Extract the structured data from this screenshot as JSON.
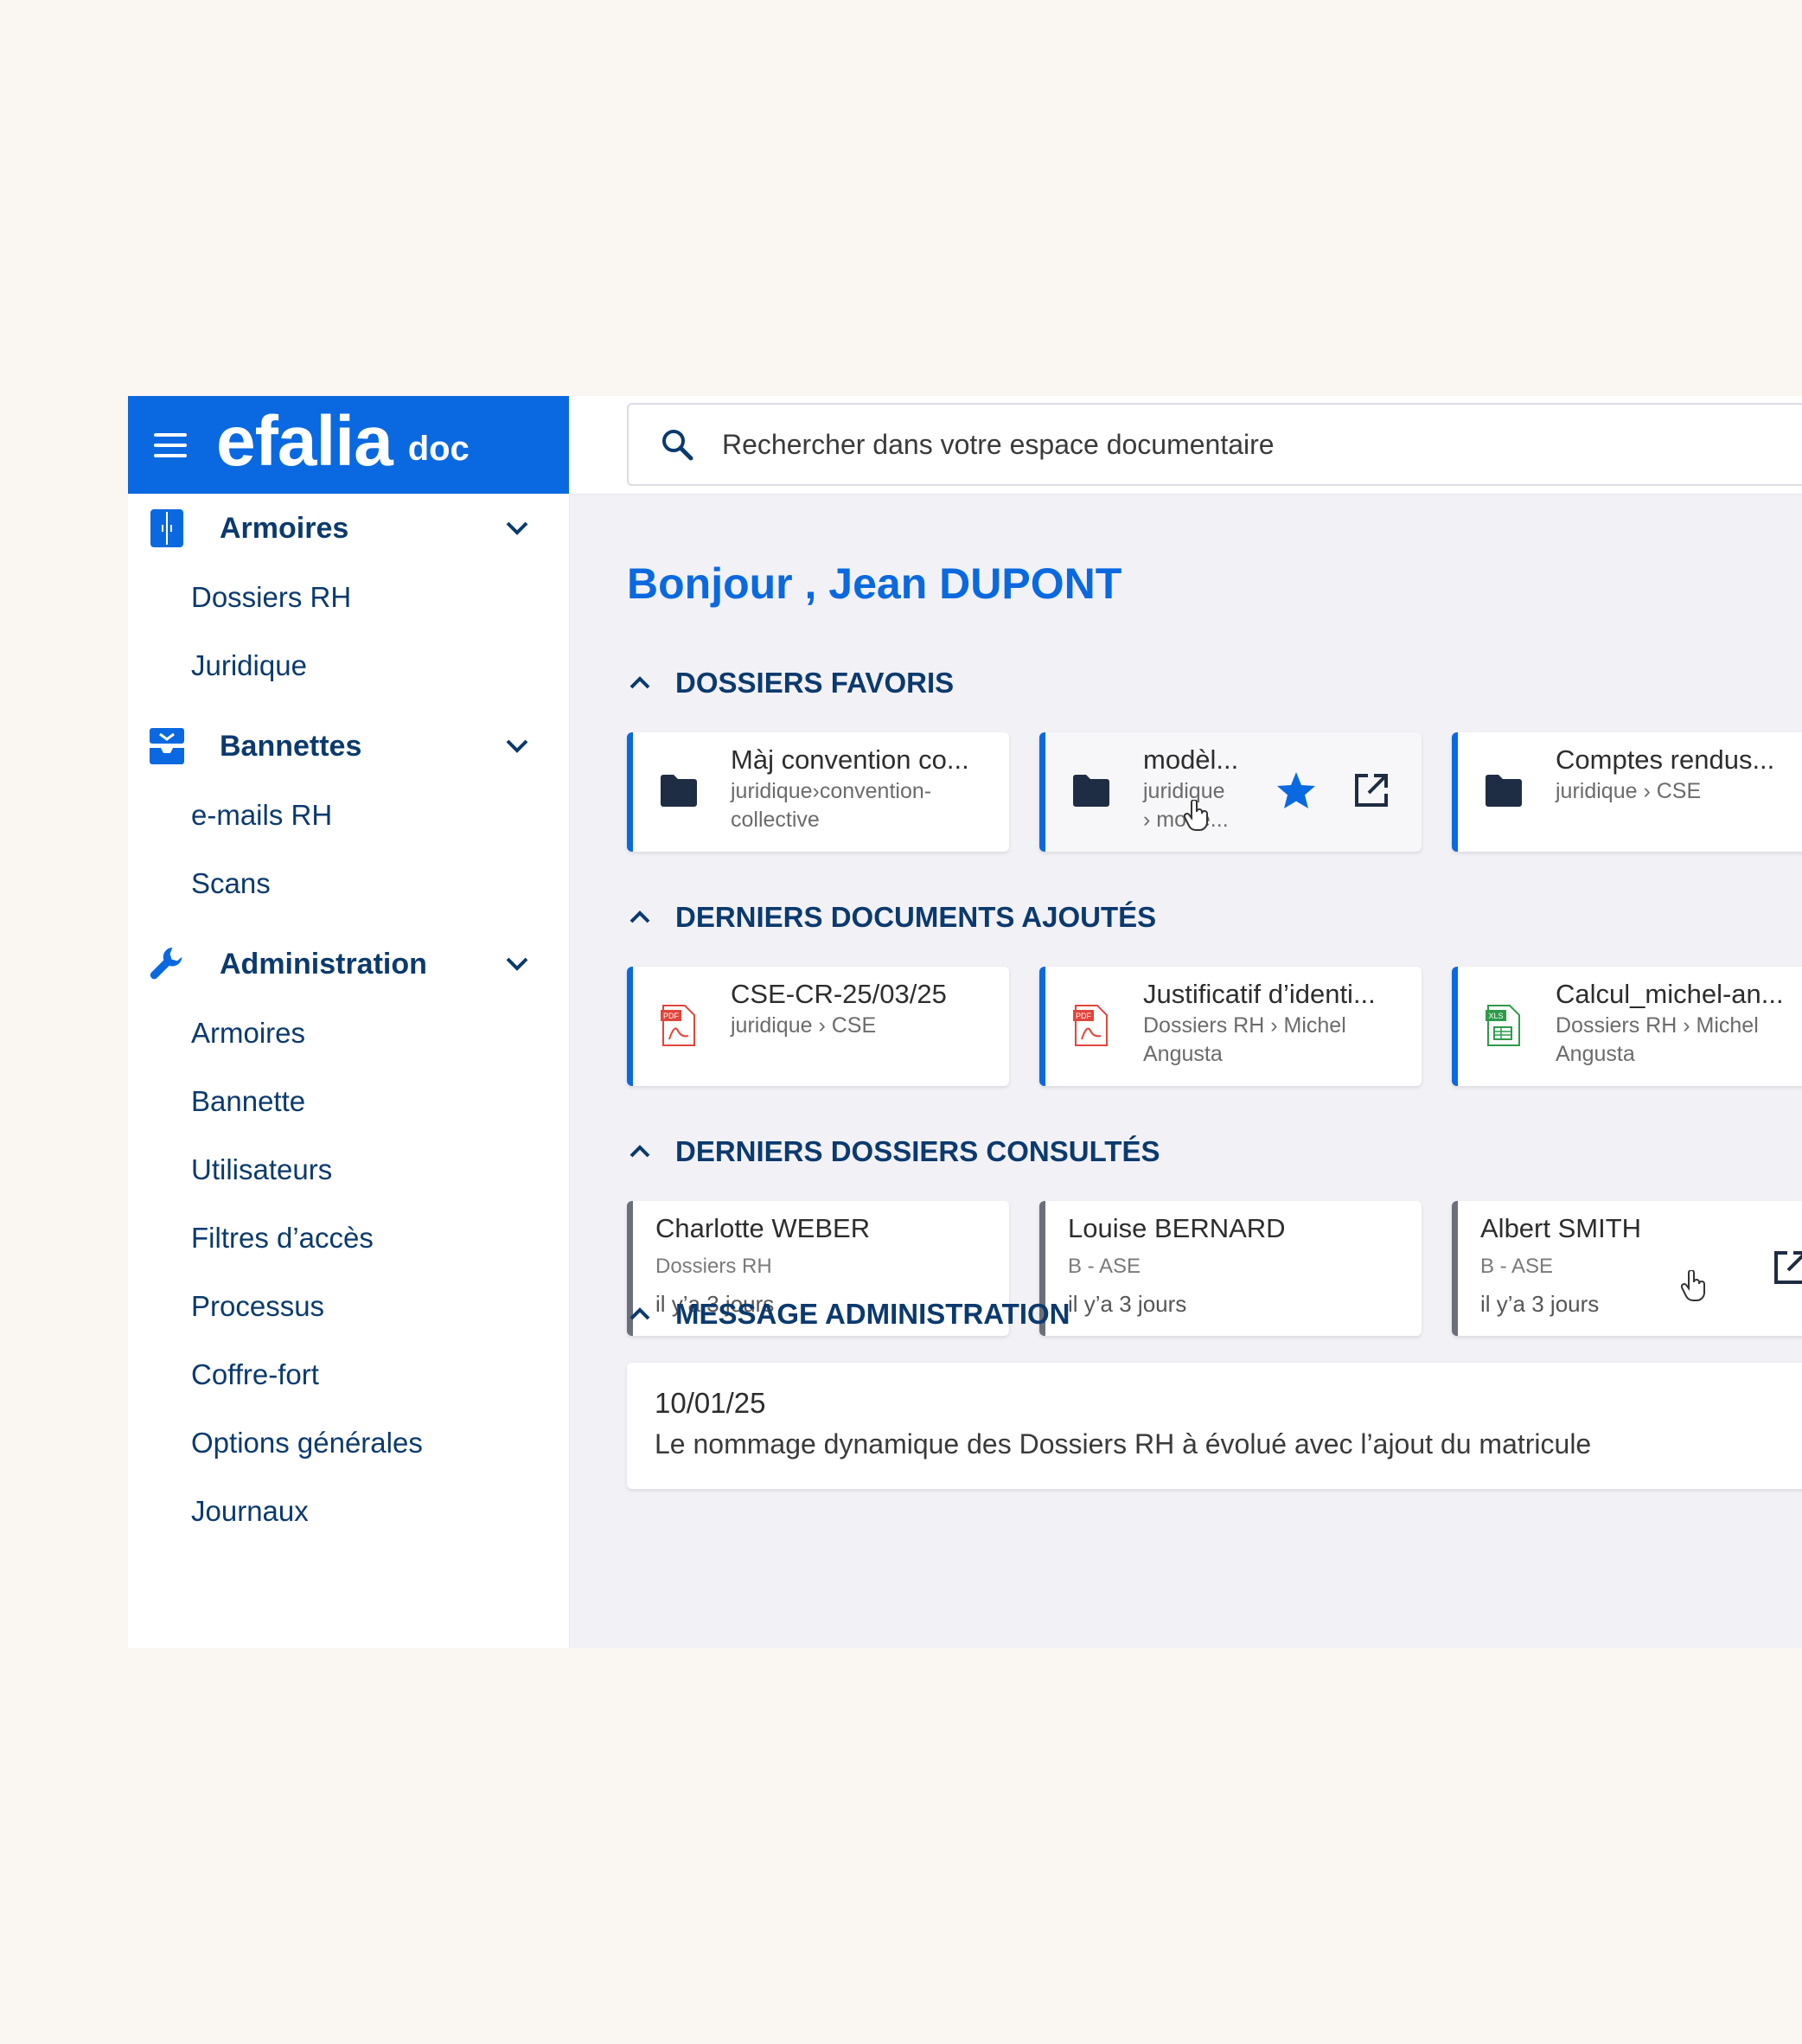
{
  "brand": {
    "name": "efalia",
    "sub": "doc"
  },
  "search": {
    "placeholder": "Rechercher dans votre espace documentaire"
  },
  "sidebar": {
    "sections": [
      {
        "label": "Armoires",
        "icon": "cabinet-icon",
        "items": [
          "Dossiers RH",
          "Juridique"
        ]
      },
      {
        "label": "Bannettes",
        "icon": "inbox-tray-icon",
        "items": [
          "e-mails RH",
          "Scans"
        ]
      },
      {
        "label": "Administration",
        "icon": "wrench-icon",
        "items": [
          "Armoires",
          "Bannette",
          "Utilisateurs",
          "Filtres d’accès",
          "Processus",
          "Coffre-fort",
          "Options générales",
          "Journaux"
        ]
      }
    ]
  },
  "main": {
    "greeting": "Bonjour , Jean DUPONT",
    "favorites": {
      "title": "DOSSIERS FAVORIS",
      "cards": [
        {
          "title": "Màj convention co...",
          "sub1": "juridique›convention-",
          "sub2": "collective",
          "icon": "folder-icon"
        },
        {
          "title": "modèl...",
          "sub1": "juridique",
          "sub2": "› modè...",
          "icon": "folder-icon"
        },
        {
          "title": "Comptes rendus...",
          "sub1": "juridique › CSE",
          "sub2": "",
          "icon": "folder-icon"
        }
      ]
    },
    "recent_docs": {
      "title": "DERNIERS DOCUMENTS AJOUTÉS",
      "cards": [
        {
          "title": "CSE-CR-25/03/25",
          "sub1": "juridique › CSE",
          "sub2": "",
          "icon": "pdf-icon",
          "badge": "PDF"
        },
        {
          "title": "Justificatif d’identi...",
          "sub1": "Dossiers RH › Michel",
          "sub2": "Angusta",
          "icon": "pdf-icon",
          "badge": "PDF"
        },
        {
          "title": "Calcul_michel-an...",
          "sub1": "Dossiers RH › Michel",
          "sub2": "Angusta",
          "icon": "xls-icon",
          "badge": "XLS"
        }
      ]
    },
    "recent_folders": {
      "title": "DERNIERS DOSSIERS CONSULTÉS",
      "cards": [
        {
          "name": "Charlotte WEBER",
          "path": "Dossiers RH",
          "time": "il y’a 3 jours"
        },
        {
          "name": "Louise BERNARD",
          "path": "B - ASE",
          "time": "il y’a 3 jours"
        },
        {
          "name": "Albert SMITH",
          "path": "B - ASE",
          "time": "il y’a 3 jours"
        }
      ]
    },
    "admin_message": {
      "title": "MESSAGE ADMINISTRATION",
      "date": "10/01/25",
      "text": "Le nommage dynamique des Dossiers RH à évolué avec l’ajout du matricule"
    }
  },
  "colors": {
    "accent": "#0a69e0",
    "navy": "#0b3a6e",
    "pdf": "#e2453c",
    "xls": "#2e9b4a"
  }
}
